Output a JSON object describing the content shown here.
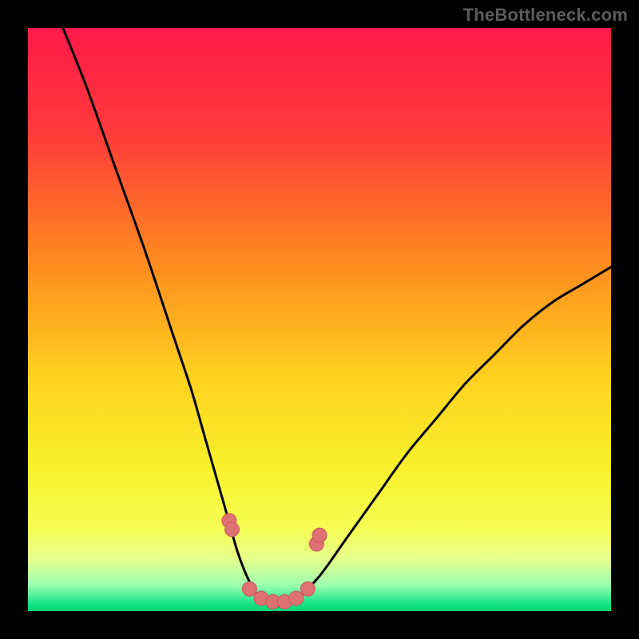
{
  "watermark": {
    "text": "TheBottleneck.com"
  },
  "colors": {
    "frame": "#000000",
    "curve_stroke": "#000000",
    "marker_fill": "#de7172",
    "marker_stroke": "#c9575a"
  },
  "chart_data": {
    "type": "line",
    "title": "",
    "xlabel": "",
    "ylabel": "",
    "xlim": [
      0,
      100
    ],
    "ylim": [
      0,
      100
    ],
    "gradient_stops": [
      {
        "offset": 0.0,
        "color": "#ff1a4a"
      },
      {
        "offset": 0.18,
        "color": "#ff3a3a"
      },
      {
        "offset": 0.4,
        "color": "#ff8a1f"
      },
      {
        "offset": 0.6,
        "color": "#ffd21f"
      },
      {
        "offset": 0.75,
        "color": "#f8f02a"
      },
      {
        "offset": 0.86,
        "color": "#f6ff55"
      },
      {
        "offset": 0.91,
        "color": "#e6ff8a"
      },
      {
        "offset": 0.955,
        "color": "#9effb0"
      },
      {
        "offset": 0.985,
        "color": "#1fe68a"
      },
      {
        "offset": 1.0,
        "color": "#00d477"
      }
    ],
    "series": [
      {
        "name": "bottleneck-curve",
        "x": [
          6,
          10,
          15,
          20,
          25,
          28,
          30,
          32,
          34,
          36,
          38,
          40,
          42,
          44,
          46,
          50,
          55,
          60,
          65,
          70,
          75,
          80,
          85,
          90,
          95,
          100
        ],
        "y": [
          100,
          90,
          76,
          62,
          47,
          38,
          31,
          24,
          17,
          10,
          5,
          2,
          1,
          1,
          2,
          6,
          13,
          20,
          27,
          33,
          39,
          44,
          49,
          53,
          56,
          59
        ]
      }
    ],
    "markers": {
      "name": "highlight-dots",
      "x": [
        34.5,
        35.0,
        38.0,
        40.0,
        42.0,
        44.0,
        46.0,
        48.0,
        49.5,
        50.0
      ],
      "y": [
        15.5,
        14.0,
        3.8,
        2.2,
        1.6,
        1.6,
        2.2,
        3.8,
        11.5,
        13.0
      ]
    }
  }
}
